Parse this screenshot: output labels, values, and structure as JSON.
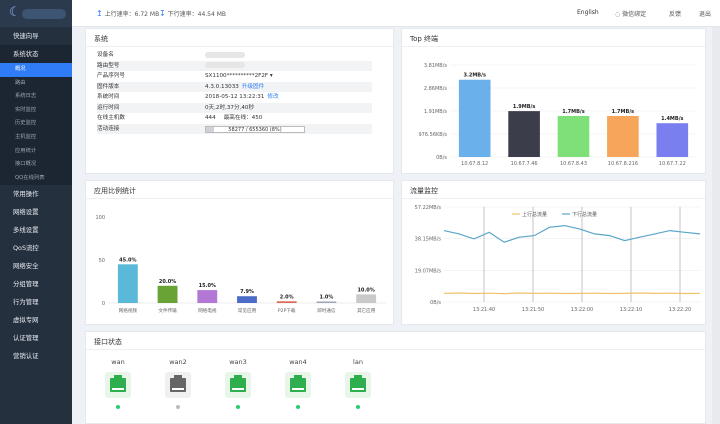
{
  "header": {
    "upload_label": "上行速率：",
    "upload_value": "6.72 MB",
    "download_label": "下行速率：",
    "download_value": "44.54 MB",
    "language": "English",
    "wechat": "微信绑定",
    "feedback": "反馈",
    "logout": "退出"
  },
  "sidebar": {
    "items": [
      {
        "label": "快速向导"
      },
      {
        "label": "系统状态"
      },
      {
        "label": "概况",
        "sub": true,
        "active": true
      },
      {
        "label": "路由",
        "sub": true
      },
      {
        "label": "系统日志",
        "sub": true
      },
      {
        "label": "实时监控",
        "sub": true
      },
      {
        "label": "历史监控",
        "sub": true
      },
      {
        "label": "主机监控",
        "sub": true
      },
      {
        "label": "应用统计",
        "sub": true
      },
      {
        "label": "接口概况",
        "sub": true
      },
      {
        "label": "QQ在线列表",
        "sub": true
      },
      {
        "label": "常用操作"
      },
      {
        "label": "网络设置"
      },
      {
        "label": "多线设置"
      },
      {
        "label": "QoS流控"
      },
      {
        "label": "网络安全"
      },
      {
        "label": "分组管理"
      },
      {
        "label": "行为管理"
      },
      {
        "label": "虚拟专网"
      },
      {
        "label": "认证管理"
      },
      {
        "label": "营销认证"
      }
    ]
  },
  "system": {
    "title": "系统",
    "rows": [
      {
        "k": "设备名",
        "v": ""
      },
      {
        "k": "路由型号",
        "v": ""
      },
      {
        "k": "产品序列号",
        "v": "SX1100**********2F2F"
      },
      {
        "k": "固件版本",
        "v": "4.3.0.13033",
        "link": "升级固件"
      },
      {
        "k": "系统时间",
        "v": "2018-05-12 13:22:31",
        "link": "修改"
      },
      {
        "k": "运行时间",
        "v": "0天,2时,37分,40秒"
      },
      {
        "k": "在线主机数",
        "v": "444",
        "v2": "最高在线：",
        "v3": "450"
      },
      {
        "k": "活动连接",
        "progress": "58277 / 655360 (8%)",
        "fraction": 0.08
      }
    ]
  },
  "top": {
    "title": "Top 终端",
    "yticks": [
      "3.81MB/s",
      "2.86MB/s",
      "1.91MB/s",
      "976.56KB/s",
      "0B/s"
    ]
  },
  "apps": {
    "title": "应用比例统计",
    "yticks": [
      "100",
      "50",
      "0"
    ]
  },
  "traffic": {
    "title": "流量监控",
    "yticks": [
      "57.22MB/s",
      "38.15MB/s",
      "19.07MB/s",
      "0B/s"
    ],
    "xticks": [
      "13:21:40",
      "13:21:50",
      "13:22:00",
      "13:22:10",
      "13:22:20"
    ],
    "legend_up": "上行总流量",
    "legend_down": "下行总流量"
  },
  "interfaces": {
    "title": "接口状态",
    "ports": [
      {
        "name": "wan",
        "up": true
      },
      {
        "name": "wan2",
        "up": false
      },
      {
        "name": "wan3",
        "up": true
      },
      {
        "name": "wan4",
        "up": true
      },
      {
        "name": "lan",
        "up": true
      }
    ]
  },
  "chart_data": [
    {
      "type": "bar",
      "title": "Top 终端",
      "categories": [
        "10.67.8.12",
        "10.67.7.46",
        "10.67.8.43",
        "10.67.8.216",
        "10.67.7.22"
      ],
      "values": [
        3.2,
        1.9,
        1.7,
        1.7,
        1.4
      ],
      "labels": [
        "3.2MB/s",
        "1.9MB/s",
        "1.7MB/s",
        "1.7MB/s",
        "1.4MB/s"
      ],
      "colors": [
        "#6ab0ea",
        "#3b3d4a",
        "#7fe07a",
        "#f6a55a",
        "#7a7ff0"
      ],
      "ylim": [
        0,
        3.81
      ]
    },
    {
      "type": "bar",
      "title": "应用比例统计",
      "categories": [
        "网络视频",
        "文件传输",
        "网络电视",
        "常见应用",
        "P2P下载",
        "即时通信",
        "其它应用"
      ],
      "values": [
        45.0,
        20.0,
        15.0,
        7.9,
        2.0,
        1.0,
        10.0
      ],
      "labels": [
        "45.0%",
        "20.0%",
        "15.0%",
        "7.9%",
        "2.0%",
        "1.0%",
        "10.0%"
      ],
      "colors": [
        "#5ab9d8",
        "#6aa335",
        "#b377d6",
        "#4b6cc8",
        "#e06a5a",
        "#9aa6b8",
        "#c9c9c9"
      ],
      "ylim": [
        0,
        100
      ]
    },
    {
      "type": "line",
      "title": "流量监控",
      "x": [
        "13:21:40",
        "13:21:50",
        "13:22:00",
        "13:22:10",
        "13:22:20"
      ],
      "ylim": [
        0,
        57.22
      ],
      "series": [
        {
          "name": "上行总流量",
          "color": "#f0c36a",
          "values": [
            5.2,
            5.4,
            5.1,
            5.3,
            5.0,
            5.4,
            5.2,
            5.3,
            5.1,
            5.2,
            5.3,
            5.1,
            5.2,
            5.4,
            5.2,
            5.3,
            5.1,
            5.2
          ]
        },
        {
          "name": "下行总流量",
          "color": "#5aa6c8",
          "values": [
            43,
            41,
            38,
            42,
            36,
            39,
            40,
            45,
            46,
            44,
            41,
            40,
            37,
            39,
            41,
            43,
            42,
            41
          ]
        }
      ]
    }
  ]
}
